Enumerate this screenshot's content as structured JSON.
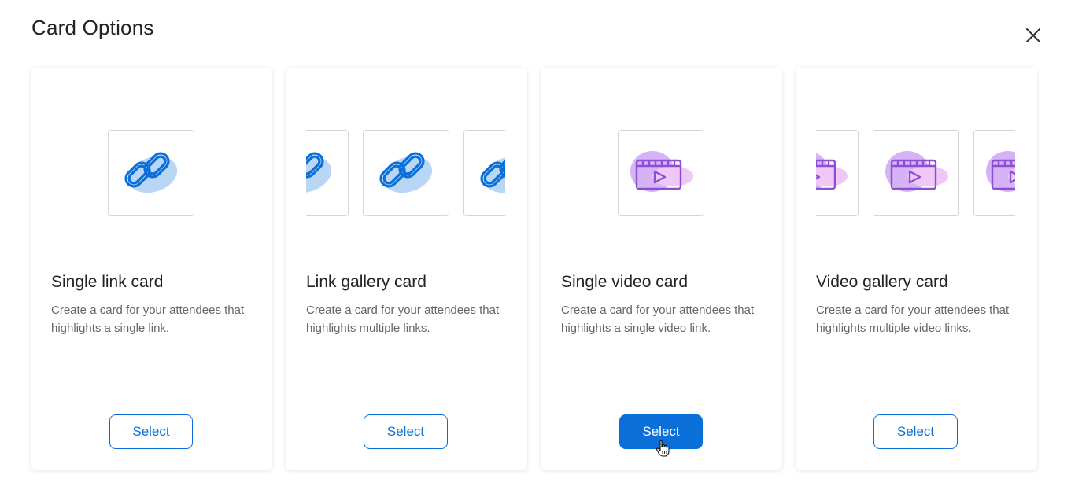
{
  "modal": {
    "title": "Card Options",
    "close_icon": "close-icon"
  },
  "cards": [
    {
      "title": "Single link card",
      "description": "Create a card for your attendees that highlights a single link.",
      "button_label": "Select",
      "icon": "link-icon",
      "selected": false
    },
    {
      "title": "Link gallery card",
      "description": "Create a card for your attendees that highlights multiple links.",
      "button_label": "Select",
      "icon": "link-icon",
      "selected": false
    },
    {
      "title": "Single video card",
      "description": "Create a card for your attendees that highlights a single video link.",
      "button_label": "Select",
      "icon": "video-icon",
      "selected": true
    },
    {
      "title": "Video gallery card",
      "description": "Create a card for your attendees that highlights multiple video links.",
      "button_label": "Select",
      "icon": "video-icon",
      "selected": false
    }
  ],
  "colors": {
    "accent": "#0a6fd8",
    "link_icon_blob": "#b9d7f5",
    "video_icon_blob": "#c99af0",
    "video_icon_stroke": "#8a4fd2"
  }
}
